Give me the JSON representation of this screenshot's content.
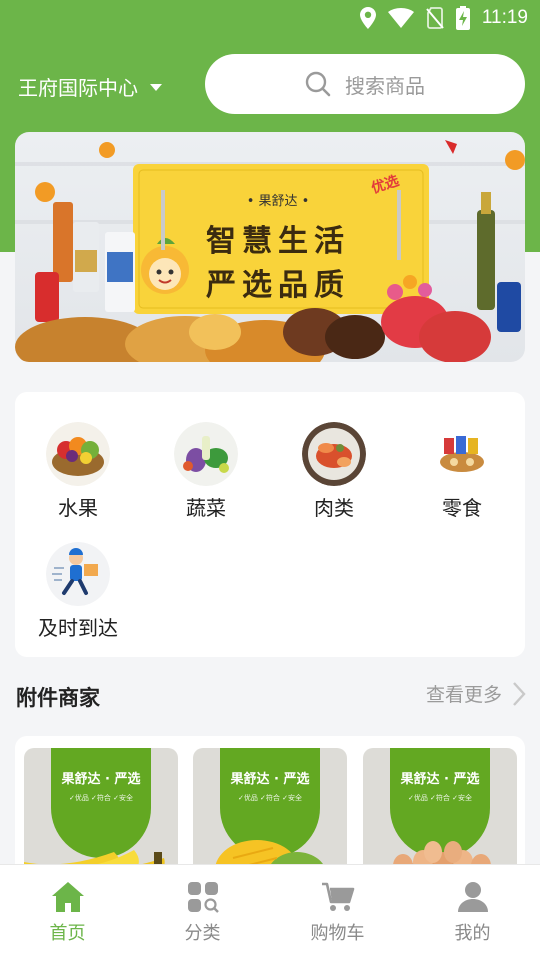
{
  "status_bar": {
    "time": "11:19"
  },
  "header": {
    "location": "王府国际中心",
    "search_placeholder": "搜索商品"
  },
  "banner": {
    "brand": "• 果舒达 •",
    "line1": "智慧生活",
    "line2": "严选品质",
    "tag": "优选"
  },
  "categories": [
    {
      "label": "水果",
      "icon": "fruit-basket"
    },
    {
      "label": "蔬菜",
      "icon": "vegetables"
    },
    {
      "label": "肉类",
      "icon": "seafood-meat"
    },
    {
      "label": "零食",
      "icon": "snacks"
    },
    {
      "label": "及时到达",
      "icon": "delivery-man"
    }
  ],
  "merchants_section": {
    "title": "附件商家",
    "more": "查看更多"
  },
  "merchants": [
    {
      "title": "果舒达 · 严选",
      "sub": "✓优品  ✓符合  ✓安全",
      "product": "bananas"
    },
    {
      "title": "果舒达 · 严选",
      "sub": "✓优品  ✓符合  ✓安全",
      "product": "mango"
    },
    {
      "title": "果舒达 · 严选",
      "sub": "✓优品  ✓符合  ✓安全",
      "product": "eggs"
    }
  ],
  "tabbar": {
    "items": [
      {
        "label": "首页",
        "icon": "home-icon",
        "active": true
      },
      {
        "label": "分类",
        "icon": "category-icon",
        "active": false
      },
      {
        "label": "购物车",
        "icon": "cart-icon",
        "active": false
      },
      {
        "label": "我的",
        "icon": "user-icon",
        "active": false
      }
    ]
  },
  "colors": {
    "primary": "#6cb549",
    "background": "#f4f5f7",
    "banner_yellow": "#f9d33a"
  }
}
